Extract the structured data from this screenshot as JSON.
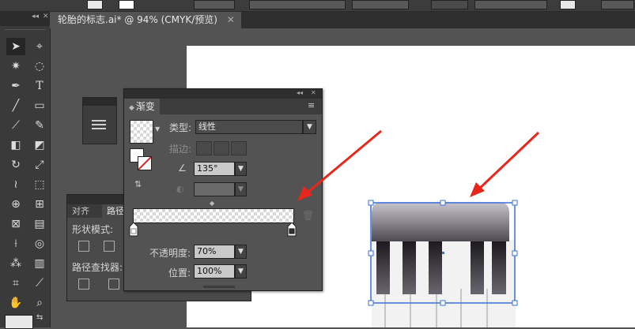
{
  "document_tab": {
    "title": "轮胎的标志.ai* @ 94% (CMYK/预览)"
  },
  "gradient_panel": {
    "title": "渐变",
    "type_label": "类型:",
    "type_value": "线性",
    "stroke_label": "描边:",
    "angle_value": "135°",
    "opacity_label": "不透明度:",
    "opacity_value": "70%",
    "position_label": "位置:",
    "position_value": "100%"
  },
  "path_panel": {
    "tabs": [
      "对齐",
      "路径"
    ],
    "shape_modes_label": "形状模式:",
    "pathfinder_label": "路径查找器:"
  },
  "colors": {
    "annotation_arrow": "#e8261c",
    "selection": "#3a6fd8",
    "panel_bg": "#535353",
    "artboard": "#ffffff"
  },
  "icons": [
    "selection-arrow-icon",
    "direct-selection-icon",
    "magic-wand-icon",
    "lasso-icon",
    "pen-icon",
    "type-icon",
    "line-icon",
    "rectangle-icon",
    "paintbrush-icon",
    "pencil-icon",
    "blob-brush-icon",
    "eraser-icon",
    "rotate-icon",
    "scale-icon",
    "warp-icon",
    "free-transform-icon",
    "shape-builder-icon",
    "perspective-grid-icon",
    "mesh-icon",
    "gradient-icon",
    "eyedropper-icon",
    "blend-icon",
    "symbol-sprayer-icon",
    "column-graph-icon",
    "artboard-icon",
    "slice-icon",
    "hand-icon",
    "zoom-icon"
  ]
}
